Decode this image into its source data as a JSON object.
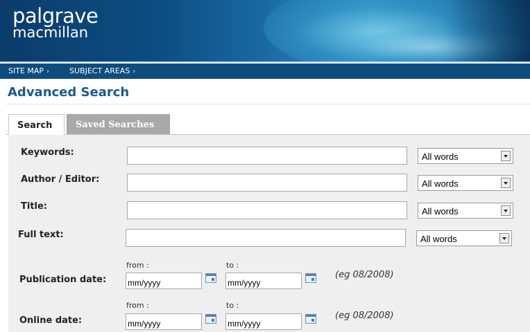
{
  "brand": {
    "line1": "palgrave",
    "line2": "macmillan"
  },
  "nav": {
    "items": [
      "SITE MAP",
      "SUBJECT AREAS"
    ],
    "separator": "›"
  },
  "page_title": "Advanced Search",
  "tabs": [
    {
      "label": "Search",
      "active": true
    },
    {
      "label": "Saved Searches",
      "active": false
    }
  ],
  "fields": [
    {
      "label": "Keywords:",
      "value": "",
      "match": "All words"
    },
    {
      "label": "Author / Editor:",
      "value": "",
      "match": "All words"
    },
    {
      "label": "Title:",
      "value": "",
      "match": "All words"
    },
    {
      "label": "Full text:",
      "value": "",
      "match": "All words"
    }
  ],
  "dates": [
    {
      "label": "Publication date:",
      "from_label": "from :",
      "to_label": "to :",
      "from_placeholder": "mm/yyyy",
      "to_placeholder": "mm/yyyy",
      "example": "(eg 08/2008)"
    },
    {
      "label": "Online date:",
      "from_label": "from :",
      "to_label": "to :",
      "from_placeholder": "mm/yyyy",
      "to_placeholder": "mm/yyyy",
      "example": "(eg 08/2008)"
    }
  ],
  "colors": {
    "nav_bg": "#0e4c7e",
    "title": "#1a5a8c",
    "panel": "#efefef",
    "inactive_tab": "#a9a9a9"
  }
}
